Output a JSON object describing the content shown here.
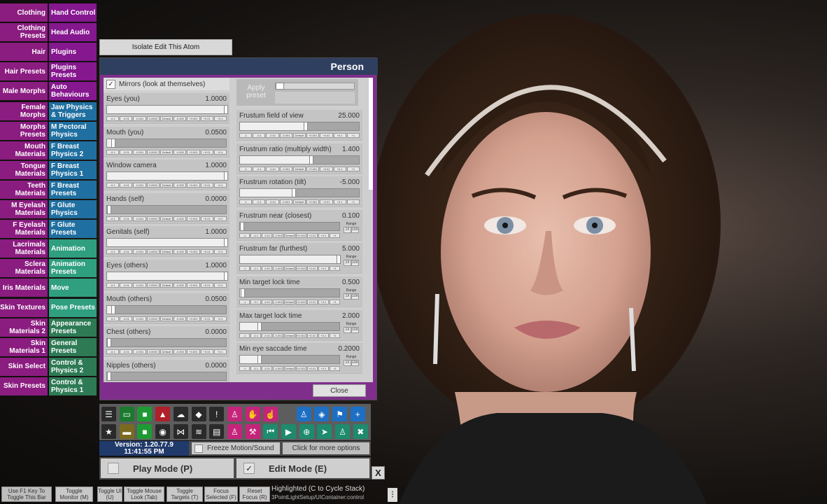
{
  "left_tabs": {
    "left": [
      {
        "label": "Clothing",
        "color": "#8b1c80"
      },
      {
        "label": "Clothing Presets",
        "color": "#8b1c80"
      },
      {
        "label": "Hair",
        "color": "#8b1c80"
      },
      {
        "label": "Hair Presets",
        "color": "#8b1c80"
      },
      {
        "label": "Male Morphs",
        "color": "#8b1c80"
      },
      {
        "label": "Female Morphs",
        "color": "#8b1c80"
      },
      {
        "label": "Morphs Presets",
        "color": "#8b1c80"
      },
      {
        "label": "Mouth Materials",
        "color": "#8b1c80"
      },
      {
        "label": "Tongue Materials",
        "color": "#8b1c80"
      },
      {
        "label": "Teeth Materials",
        "color": "#8b1c80"
      },
      {
        "label": "M Eyelash Materials",
        "color": "#8b1c80"
      },
      {
        "label": "F Eyelash Materials",
        "color": "#8b1c80"
      },
      {
        "label": "Lacrimals Materials",
        "color": "#8b1c80"
      },
      {
        "label": "Sclera Materials",
        "color": "#8b1c80"
      },
      {
        "label": "Iris Materials",
        "color": "#8b1c80"
      },
      {
        "label": "Skin Textures",
        "color": "#8b1c80"
      },
      {
        "label": "Skin Materials 2",
        "color": "#8b1c80"
      },
      {
        "label": "Skin Materials 1",
        "color": "#8b1c80"
      },
      {
        "label": "Skin Select",
        "color": "#8b1c80"
      },
      {
        "label": "Skin Presets",
        "color": "#8b1c80"
      }
    ],
    "right": [
      {
        "label": "Hand Control",
        "color": "#85178f"
      },
      {
        "label": "Head Audio",
        "color": "#85178f"
      },
      {
        "label": "Plugins",
        "color": "#85178f"
      },
      {
        "label": "Plugins Presets",
        "color": "#85178f"
      },
      {
        "label": "Auto Behaviours",
        "color": "#85178f"
      },
      {
        "label": "Jaw Physics & Triggers",
        "color": "#1f6fa0"
      },
      {
        "label": "M Pectoral Physics",
        "color": "#1f6fa0"
      },
      {
        "label": "F Breast Physics 2",
        "color": "#1f6fa0"
      },
      {
        "label": "F Breast Physics 1",
        "color": "#1f6fa0"
      },
      {
        "label": "F Breast Presets",
        "color": "#1f6fa0"
      },
      {
        "label": "F Glute Physics",
        "color": "#1f6fa0"
      },
      {
        "label": "F Glute Presets",
        "color": "#1f6fa0"
      },
      {
        "label": "Animation",
        "color": "#2f9f7f"
      },
      {
        "label": "Animation Presets",
        "color": "#2f9f7f"
      },
      {
        "label": "Move",
        "color": "#2f9f7f"
      },
      {
        "label": "Pose Presets",
        "color": "#2f9f7f"
      },
      {
        "label": "Appearance Presets",
        "color": "#2d7a55"
      },
      {
        "label": "General Presets",
        "color": "#2d7a55"
      },
      {
        "label": "Control & Physics 2",
        "color": "#2d7a55"
      },
      {
        "label": "Control & Physics 1",
        "color": "#2d7a55"
      }
    ]
  },
  "isolate_button": "Isolate Edit This Atom",
  "panel": {
    "title": "Person",
    "mirrors_label": "Mirrors (look at themselves)",
    "apply_preset_label": "Apply preset",
    "close_label": "Close",
    "step_labels": [
      "-0.1",
      "-0.01",
      "-0.001",
      "0.0000",
      "Default",
      "-0.000",
      "+0.001",
      "+0.01",
      "+0.1"
    ],
    "step_labels_right": [
      "-1",
      "-0.1",
      "-0.01",
      "-0.001",
      "Default",
      "+0.001",
      "+0.01",
      "+0.1",
      "+1"
    ],
    "range_label": "Range",
    "range_1x": "1X",
    "range_10x": "10X",
    "left_sliders": [
      {
        "label": "Eyes (you)",
        "value": "1.0000",
        "fraction": 1.0
      },
      {
        "label": "Mouth (you)",
        "value": "0.0500",
        "fraction": 0.05
      },
      {
        "label": "Window camera",
        "value": "1.0000",
        "fraction": 1.0
      },
      {
        "label": "Hands (self)",
        "value": "0.0000",
        "fraction": 0.0
      },
      {
        "label": "Genitals (self)",
        "value": "1.0000",
        "fraction": 1.0
      },
      {
        "label": "Eyes (others)",
        "value": "1.0000",
        "fraction": 1.0
      },
      {
        "label": "Mouth (others)",
        "value": "0.0500",
        "fraction": 0.05
      },
      {
        "label": "Chest (others)",
        "value": "0.0000",
        "fraction": 0.0
      },
      {
        "label": "Nipples (others)",
        "value": "0.0000",
        "fraction": 0.0
      }
    ],
    "right_sliders": [
      {
        "label": "Frustum field of view",
        "value": "25.000",
        "fraction": 0.55,
        "range": false
      },
      {
        "label": "Frustrum ratio (multiply width)",
        "value": "1.400",
        "fraction": 0.6,
        "range": false
      },
      {
        "label": "Frustrum rotation (tilt)",
        "value": "-5.000",
        "fraction": 0.45,
        "range": false
      },
      {
        "label": "Frustrum near (closest)",
        "value": "0.100",
        "fraction": 0.02,
        "range": true
      },
      {
        "label": "Frustrum far (furthest)",
        "value": "5.000",
        "fraction": 0.99,
        "range": true
      },
      {
        "label": "Min target lock time",
        "value": "0.500",
        "fraction": 0.03,
        "range": true
      },
      {
        "label": "Max target lock time",
        "value": "2.000",
        "fraction": 0.2,
        "range": true
      },
      {
        "label": "Min eye saccade time",
        "value": "0.2000",
        "fraction": 0.2,
        "range": true
      }
    ]
  },
  "toolbar": {
    "row1": [
      {
        "icon": "menu-icon",
        "glyph": "☰",
        "color": "#2a2a2a"
      },
      {
        "icon": "open-scene-icon",
        "glyph": "▭",
        "color": "#1b7a2e"
      },
      {
        "icon": "folder-icon",
        "glyph": "■",
        "color": "#1e9a33"
      },
      {
        "icon": "person-save-icon",
        "glyph": "▲",
        "color": "#b0202a"
      },
      {
        "icon": "cloud-upload-icon",
        "glyph": "☁",
        "color": "#2a2a2a"
      },
      {
        "icon": "cube-icon",
        "glyph": "◆",
        "color": "#2a2a2a"
      },
      {
        "icon": "alert-icon",
        "glyph": "!",
        "color": "#2a2a2a"
      },
      {
        "icon": "person-add-icon",
        "glyph": "♙",
        "color": "#c4257a"
      },
      {
        "icon": "hand-icon",
        "glyph": "✋",
        "color": "#c4257a"
      },
      {
        "icon": "pointer-hand-icon",
        "glyph": "☝",
        "color": "#c4257a"
      },
      {
        "icon": "person-icon",
        "glyph": "♙",
        "color": "#1d6fc4"
      },
      {
        "icon": "unity-icon",
        "glyph": "◈",
        "color": "#1d6fc4"
      },
      {
        "icon": "flag-icon",
        "glyph": "⚑",
        "color": "#1d6fc4"
      },
      {
        "icon": "plus-icon",
        "glyph": "+",
        "color": "#1d6fc4"
      }
    ],
    "row2": [
      {
        "icon": "star-icon",
        "glyph": "★",
        "color": "#2a2a2a"
      },
      {
        "icon": "save-scene-icon",
        "glyph": "▬",
        "color": "#7a6a20"
      },
      {
        "icon": "folder-add-icon",
        "glyph": "■",
        "color": "#1e9a33"
      },
      {
        "icon": "camera-icon",
        "glyph": "◉",
        "color": "#2a2a2a"
      },
      {
        "icon": "share-icon",
        "glyph": "⋈",
        "color": "#2a2a2a"
      },
      {
        "icon": "layers-icon",
        "glyph": "≋",
        "color": "#2a2a2a"
      },
      {
        "icon": "document-icon",
        "glyph": "▤",
        "color": "#2a2a2a"
      },
      {
        "icon": "person-remove-icon",
        "glyph": "♙",
        "color": "#c4257a"
      },
      {
        "icon": "hammer-icon",
        "glyph": "⚒",
        "color": "#c4257a"
      },
      {
        "icon": "skip-back-icon",
        "glyph": "⏮",
        "color": "#1e8a6e"
      },
      {
        "icon": "play-icon",
        "glyph": "▶",
        "color": "#1e8a6e"
      },
      {
        "icon": "target-icon",
        "glyph": "⊕",
        "color": "#1e8a6e"
      },
      {
        "icon": "cursor-icon",
        "glyph": "➤",
        "color": "#1e8a6e"
      },
      {
        "icon": "people-icon",
        "glyph": "♙",
        "color": "#1e8a6e"
      },
      {
        "icon": "tools-icon",
        "glyph": "✖",
        "color": "#1e8a6e"
      }
    ]
  },
  "version_line1": "Version: 1.20.77.9",
  "version_line2": "11:41:55 PM",
  "freeze_label": "Freeze Motion/Sound",
  "more_options_label": "Click for more options",
  "play_mode_label": "Play Mode (P)",
  "edit_mode_label": "Edit Mode (E)",
  "close_x": "X",
  "bottom_bar": {
    "f1_toggle": "Use F1 Key To Toggle This Bar",
    "toggle_monitor": "Toggle Monitor (M)",
    "toggle_ui": "Toggle UI (U)",
    "toggle_mouse": "Toggle Mouse Look (Tab)",
    "toggle_targets": "Toggle Targets (T)",
    "focus_selected": "Focus Selected (F)",
    "reset_focus": "Reset Focus (R)",
    "highlighted": "Highlighted (C to Cycle Stack)",
    "highlighted_path": "3PointLightSetup/UIContainer:control",
    "dots": "⋮"
  }
}
